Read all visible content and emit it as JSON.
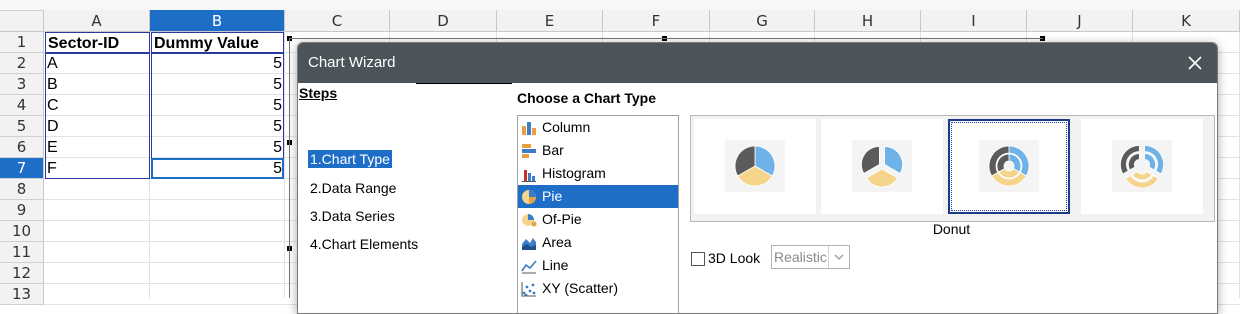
{
  "spreadsheet": {
    "columns": [
      "A",
      "B",
      "C",
      "D",
      "E",
      "F",
      "G",
      "H",
      "I",
      "J",
      "K"
    ],
    "selected_column": "B",
    "rows": [
      "1",
      "2",
      "3",
      "4",
      "5",
      "6",
      "7",
      "8",
      "9",
      "10",
      "11",
      "12",
      "13"
    ],
    "selected_row": "7",
    "header_row": {
      "a": "Sector-ID",
      "b": "Dummy Value"
    },
    "data_rows": [
      {
        "a": "A",
        "b": "5"
      },
      {
        "a": "B",
        "b": "5"
      },
      {
        "a": "C",
        "b": "5"
      },
      {
        "a": "D",
        "b": "5"
      },
      {
        "a": "E",
        "b": "5"
      },
      {
        "a": "F",
        "b": "5"
      }
    ]
  },
  "dialog": {
    "title": "Chart Wizard",
    "steps_title": "Steps",
    "steps": [
      {
        "label": "1.Chart Type",
        "active": true
      },
      {
        "label": "2.Data Range",
        "active": false
      },
      {
        "label": "3.Data Series",
        "active": false
      },
      {
        "label": "4.Chart Elements",
        "active": false
      }
    ],
    "choose_title": "Choose a Chart Type",
    "chart_types": [
      {
        "label": "Column",
        "icon": "column-chart-icon"
      },
      {
        "label": "Bar",
        "icon": "bar-chart-icon"
      },
      {
        "label": "Histogram",
        "icon": "histogram-chart-icon"
      },
      {
        "label": "Pie",
        "icon": "pie-chart-icon",
        "selected": true
      },
      {
        "label": "Of-Pie",
        "icon": "of-pie-chart-icon"
      },
      {
        "label": "Area",
        "icon": "area-chart-icon"
      },
      {
        "label": "Line",
        "icon": "line-chart-icon"
      },
      {
        "label": "XY (Scatter)",
        "icon": "scatter-chart-icon"
      }
    ],
    "variants": [
      {
        "icon": "normal-pie-icon"
      },
      {
        "icon": "exploded-pie-icon"
      },
      {
        "icon": "donut-icon",
        "selected": true
      },
      {
        "icon": "exploded-donut-icon"
      }
    ],
    "selected_variant_name": "Donut",
    "three_d_look": {
      "label": "3D Look",
      "checked": false,
      "select_value": "Realistic"
    },
    "colors": {
      "accent": "#1e6ec8",
      "titlebar": "#4b5459",
      "slice_blue": "#6fb2e8",
      "slice_gray": "#5b5b5b",
      "slice_yellow": "#f5d58c"
    }
  }
}
